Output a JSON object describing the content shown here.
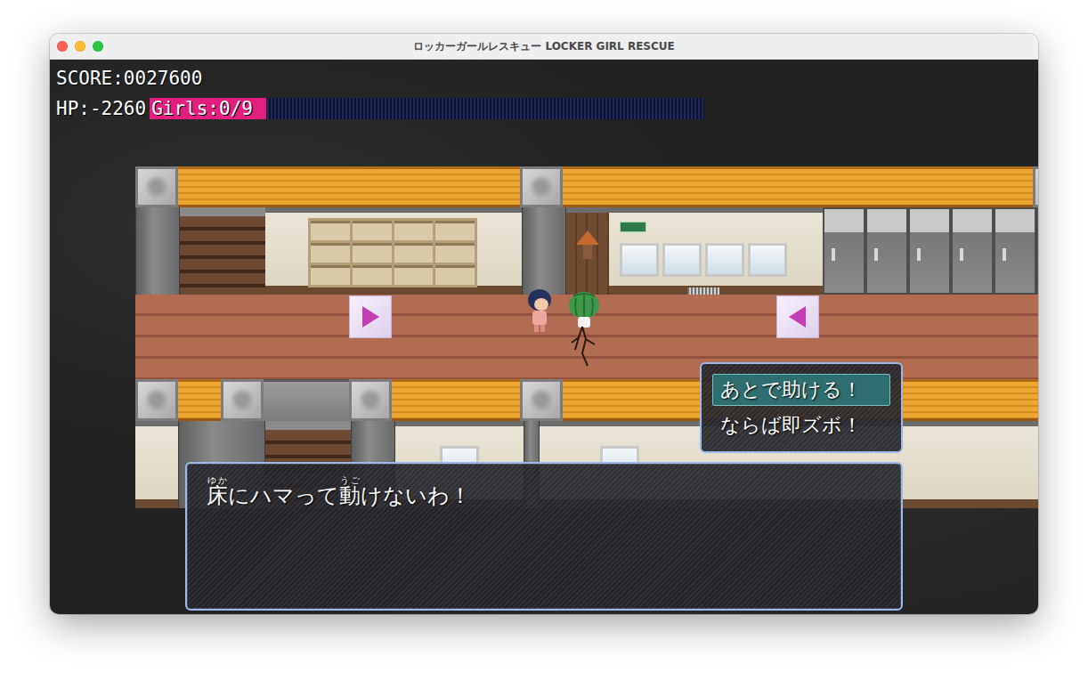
{
  "window": {
    "title": "ロッカーガールレスキュー LOCKER GIRL RESCUE"
  },
  "hud": {
    "score": "SCORE:0027600",
    "hp": "HP:-2260",
    "girls": "Girls:0/9",
    "gauge": {
      "level": 0.21
    }
  },
  "map": {
    "arrows": [
      {
        "kind": "right"
      },
      {
        "kind": "left"
      }
    ]
  },
  "choices": [
    {
      "label": "あとで助ける！",
      "selected": true
    },
    {
      "label": "ならば即ズボ！",
      "selected": false
    }
  ],
  "message": {
    "segments": [
      {
        "text": "床",
        "ruby": "ゆか"
      },
      {
        "text": "にハマって"
      },
      {
        "text": "動",
        "ruby": "うご"
      },
      {
        "text": "けないわ！"
      }
    ]
  }
}
